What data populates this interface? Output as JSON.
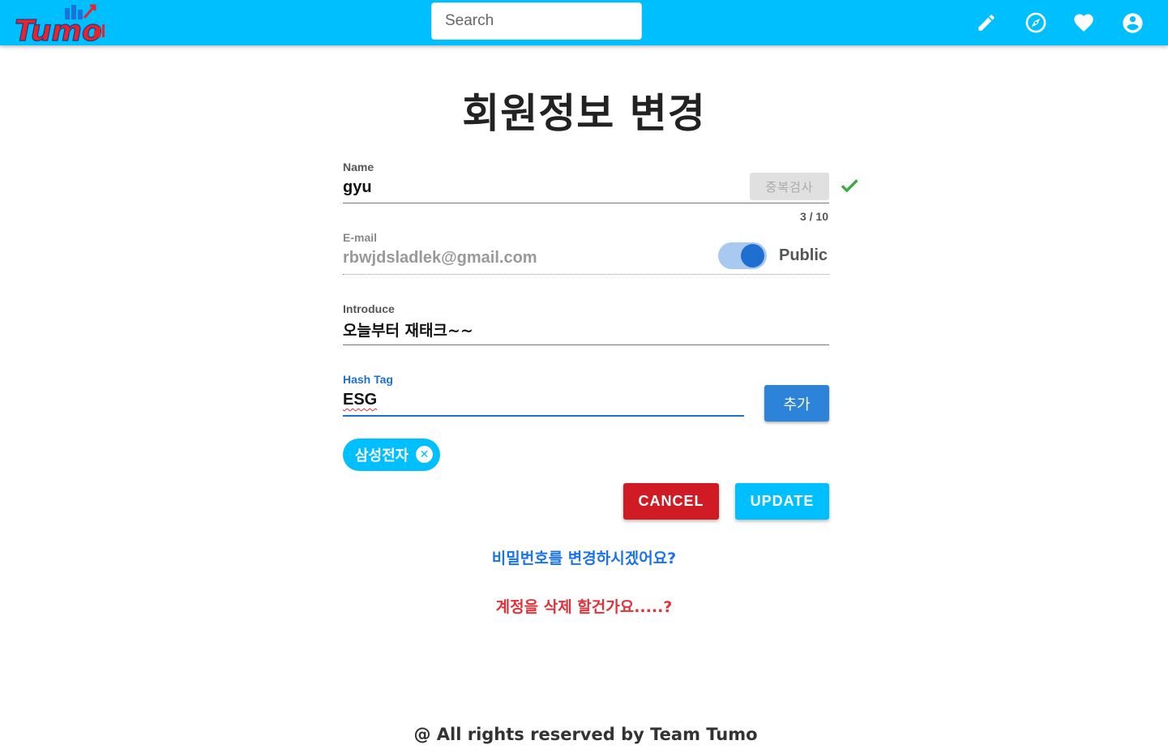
{
  "header": {
    "brand": "Tumo",
    "search": {
      "placeholder": "Search",
      "value": ""
    },
    "icons": [
      "pencil-icon",
      "compass-icon",
      "heart-icon",
      "account-circle-icon"
    ],
    "colors": {
      "bar": "#00bfff",
      "logo_red": "#e8232a",
      "logo_blue": "#1a73d9"
    }
  },
  "page": {
    "title": "회원정보 변경"
  },
  "form": {
    "name": {
      "label": "Name",
      "value": "gyu",
      "check_button": "중복검사",
      "counter": "3 / 10",
      "verified_icon": "check-icon"
    },
    "email": {
      "label": "E-mail",
      "value": "rbwjdsladlek@gmail.com",
      "toggle_label": "Public",
      "toggle_on": true
    },
    "introduce": {
      "label": "Introduce",
      "value": "오늘부터 재태크~~"
    },
    "hashtag": {
      "label": "Hash Tag",
      "value": "ESG",
      "add_button": "추가",
      "chips": [
        {
          "text": "삼성전자",
          "close_icon": "close-circle-icon"
        }
      ]
    },
    "actions": {
      "cancel": "CANCEL",
      "update": "UPDATE"
    }
  },
  "links": {
    "change_password": "비밀번호를 변경하시겠어요?",
    "delete_account": "계정을 삭제 할건가요.....?"
  },
  "footer": {
    "text": "@ All rights reserved by Team Tumo"
  },
  "colors": {
    "accent": "#00bfff",
    "primary_blue": "#2d83d8",
    "danger": "#d01b24",
    "link_blue": "#1a73e8",
    "link_red": "#e0323a",
    "success": "#3daa47"
  }
}
